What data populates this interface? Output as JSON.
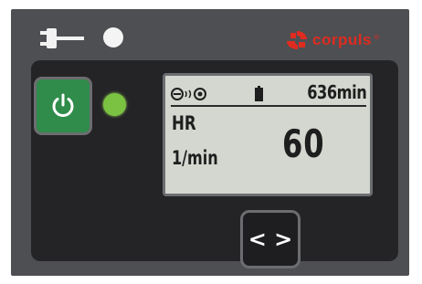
{
  "device": {
    "brand": "corpuls",
    "brand_reg": "®",
    "colors": {
      "body": "#4e4f52",
      "panel": "#242426",
      "power_button": "#2f8c4a",
      "status_led": "#7cc242",
      "brand": "#e02b20",
      "lcd": "#d3d7cf"
    },
    "icons": {
      "power_plug": "power-plug-icon",
      "power_symbol": "power-icon",
      "status_icons": "patient-status-icons"
    }
  },
  "display": {
    "battery_runtime": "636min",
    "parameter_label": "HR",
    "parameter_unit": "1/min",
    "parameter_value": "60"
  },
  "controls": {
    "nav_label": "< >"
  }
}
